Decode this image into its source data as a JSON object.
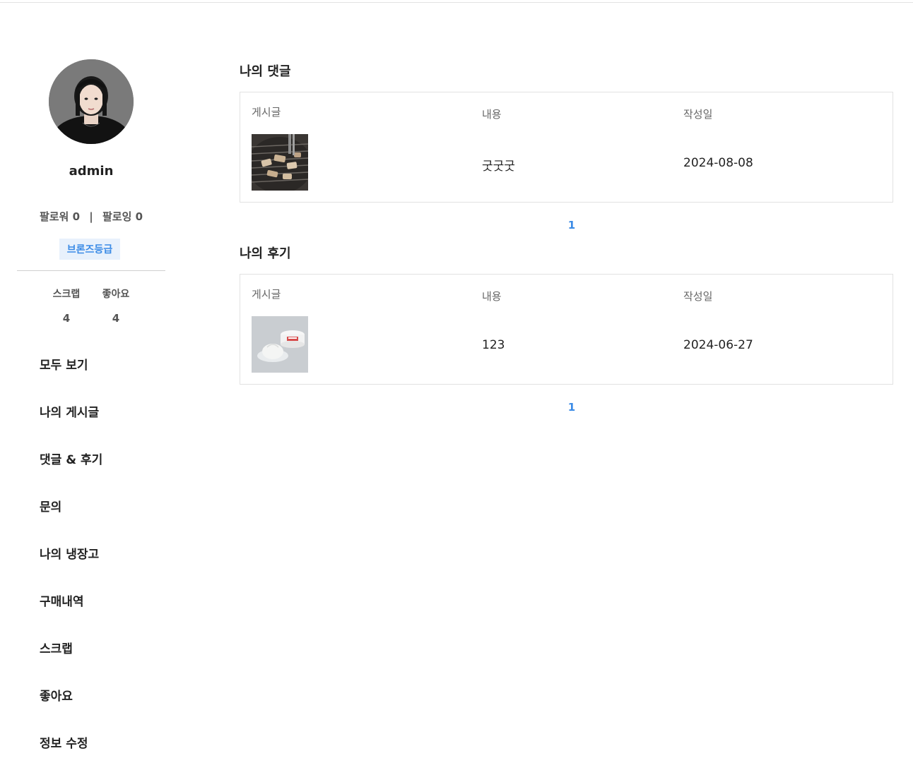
{
  "profile": {
    "username": "admin",
    "follower_label": "팔로워",
    "follower_count": "0",
    "following_label": "팔로잉",
    "following_count": "0",
    "separator": "|",
    "grade": "브론즈등급",
    "stats": {
      "scrap_label": "스크랩",
      "scrap_value": "4",
      "like_label": "좋아요",
      "like_value": "4"
    }
  },
  "menu": [
    {
      "label": "모두 보기"
    },
    {
      "label": "나의 게시글"
    },
    {
      "label": "댓글 & 후기"
    },
    {
      "label": "문의"
    },
    {
      "label": "나의 냉장고"
    },
    {
      "label": "구매내역"
    },
    {
      "label": "스크랩"
    },
    {
      "label": "좋아요"
    },
    {
      "label": "정보 수정"
    }
  ],
  "comments": {
    "title": "나의 댓글",
    "headers": [
      "게시글",
      "내용",
      "작성일"
    ],
    "rows": [
      {
        "thumbnail": "grilled-meat-photo",
        "content": "굿굿굿",
        "date": "2024-08-08"
      }
    ],
    "page": "1"
  },
  "reviews": {
    "title": "나의 후기",
    "headers": [
      "게시글",
      "내용",
      "작성일"
    ],
    "rows": [
      {
        "thumbnail": "burrata-cheese-photo",
        "content": "123",
        "date": "2024-06-27"
      }
    ],
    "page": "1"
  },
  "colors": {
    "accent": "#3b8be6",
    "grade_bg": "#e8f1fc",
    "border": "#e2e2e2"
  }
}
